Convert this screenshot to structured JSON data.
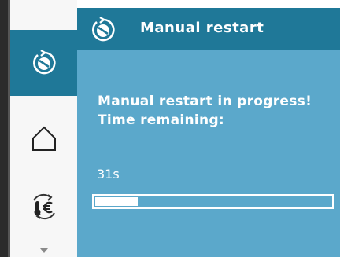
{
  "header": {
    "title": "Manual restart",
    "icon": "manual-restart-icon"
  },
  "sidebar": {
    "items": [
      {
        "icon": "manual-restart-icon",
        "active": true
      },
      {
        "icon": "home-icon",
        "active": false
      },
      {
        "icon": "energy-icon",
        "active": false
      }
    ],
    "more_indicator": "chevron-down-icon"
  },
  "main": {
    "message_line1": "Manual restart in progress!",
    "message_line2": "Time remaining:",
    "time_remaining": "31s",
    "progress_fraction": 0.18
  },
  "colors": {
    "accent": "#1f7898",
    "panel": "#5ba8cb",
    "text": "#ffffff"
  }
}
